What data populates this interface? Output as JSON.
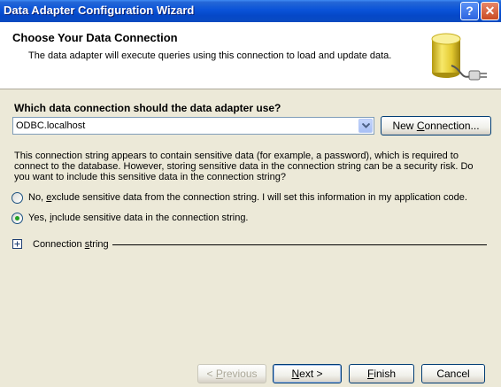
{
  "window": {
    "title": "Data Adapter Configuration Wizard",
    "help_label": "?",
    "close_label": "✕"
  },
  "header": {
    "title": "Choose Your Data Connection",
    "subtitle": "The data adapter will execute queries using this connection to load and update data."
  },
  "connection": {
    "question": "Which data connection should the data adapter use?",
    "selected": "ODBC.localhost",
    "new_connection_pre": "New ",
    "new_connection_underlined": "C",
    "new_connection_post": "onnection..."
  },
  "sensitive": {
    "paragraph": "This connection string appears to contain sensitive data (for example, a password), which is required to connect to the database. However, storing sensitive data in the connection string can be a security risk. Do you want to include this sensitive data in the connection string?",
    "option_no_pre": "No, ",
    "option_no_u": "e",
    "option_no_post": "xclude sensitive data from the connection string. I will set this information in my application code.",
    "option_yes_pre": "Yes, ",
    "option_yes_u": "i",
    "option_yes_post": "nclude sensitive data in the connection string.",
    "selected": "yes"
  },
  "connection_string": {
    "pre": "Connection ",
    "u": "s",
    "post": "tring"
  },
  "buttons": {
    "previous_pre": "< ",
    "previous_u": "P",
    "previous_post": "revious",
    "next_pre": "",
    "next_u": "N",
    "next_post": "ext >",
    "finish_pre": "",
    "finish_u": "F",
    "finish_post": "inish",
    "cancel": "Cancel"
  }
}
